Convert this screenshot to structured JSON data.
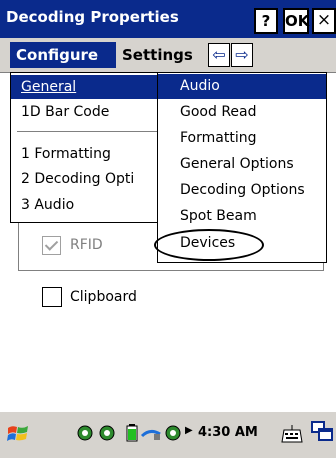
{
  "window": {
    "title": "Decoding Properties",
    "help_label": "?",
    "ok_label": "OK",
    "close_label": "×"
  },
  "menubar": {
    "configure_label": "Configure",
    "settings_label": "Settings",
    "left_arrow": "⇦",
    "right_arrow": "⇨"
  },
  "configure_menu": {
    "items": [
      {
        "label": "General",
        "selected": true
      },
      {
        "label": "1D Bar Code",
        "selected": false
      },
      {
        "label": "1 Formatting",
        "selected": false
      },
      {
        "label": "2 Decoding Opti",
        "selected": false
      },
      {
        "label": "3 Audio",
        "selected": false
      }
    ]
  },
  "general_submenu": {
    "items": [
      {
        "label": "Audio",
        "selected": true
      },
      {
        "label": "Good Read",
        "selected": false
      },
      {
        "label": "Formatting",
        "selected": false
      },
      {
        "label": "General Options",
        "selected": false
      },
      {
        "label": "Decoding Options",
        "selected": false
      },
      {
        "label": "Spot Beam",
        "selected": false
      },
      {
        "label": "Devices",
        "selected": false
      }
    ]
  },
  "form": {
    "rfid_label": "RFID",
    "rfid_checked": true,
    "rfid_enabled": false,
    "clipboard_label": "Clipboard",
    "clipboard_checked": false
  },
  "taskbar": {
    "clock": "4:30 AM",
    "icons": [
      "start-icon",
      "sync-icon",
      "sync-icon",
      "battery-icon",
      "network-icon",
      "sync-icon",
      "keyboard-icon",
      "windows-icon"
    ]
  },
  "colors": {
    "title_bar": "#0a2a8c",
    "selection": "#0a2a8c",
    "chrome": "#d6d3ce"
  }
}
